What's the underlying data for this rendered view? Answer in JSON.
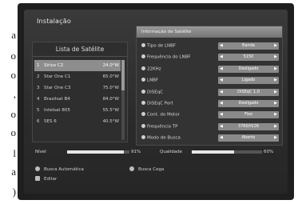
{
  "page_margin": {
    "left_glyphs": [
      "a",
      "o",
      "o",
      ",",
      "o",
      "o",
      "l",
      "a",
      ")"
    ]
  },
  "screen": {
    "title": "Instalação",
    "satellite_list": {
      "heading": "Lista de Satélite",
      "items": [
        {
          "num": "1",
          "name": "Sirius C2",
          "pos": "24.0°W",
          "selected": true
        },
        {
          "num": "2",
          "name": "Star One C1",
          "pos": "65.0°W",
          "selected": false
        },
        {
          "num": "3",
          "name": "Star One C3",
          "pos": "75.0°W",
          "selected": false
        },
        {
          "num": "4",
          "name": "Brasilsat B4",
          "pos": "84.0°W",
          "selected": false
        },
        {
          "num": "5",
          "name": "Intelsat 805",
          "pos": "55.5°W",
          "selected": false
        },
        {
          "num": "6",
          "name": "SES 6",
          "pos": "40.5°W",
          "selected": false
        }
      ]
    },
    "info_panel": {
      "heading": "Informação de Satélite",
      "rows": [
        {
          "label": "Tipo de LNBF",
          "value": "Banda"
        },
        {
          "label": "Frequência do LNBF",
          "value": "5150"
        },
        {
          "label": "22KHz",
          "value": "Desligado"
        },
        {
          "label": "LNBF",
          "value": "Ligado"
        },
        {
          "label": "DiSEqC",
          "value": "DiSEqC 1.0"
        },
        {
          "label": "DiSEqC Port",
          "value": "Desligado"
        },
        {
          "label": "Cont. do Motor",
          "value": "Fixo"
        },
        {
          "label": "Frequência TP",
          "value": "3760/H/26"
        },
        {
          "label": "Modo de Busca",
          "value": "Aberto"
        }
      ]
    },
    "signal": {
      "level_label": "Nível",
      "level_value": 0.91,
      "level_text": "91%",
      "quality_label": "Qualidade",
      "quality_value": 0.6,
      "quality_text": "60%"
    },
    "hints": {
      "auto_search": "Busca Automática",
      "blind_search": "Busca Cega",
      "edit": "Editar"
    }
  }
}
